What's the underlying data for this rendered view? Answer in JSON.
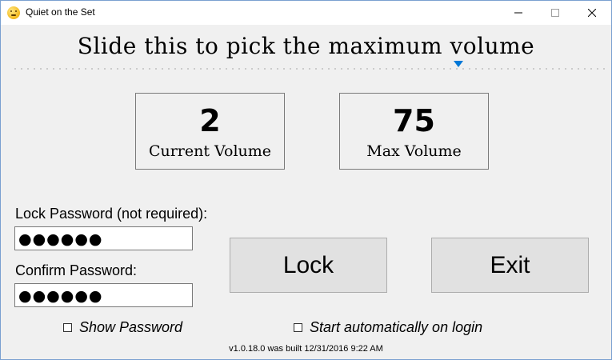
{
  "window": {
    "title": "Quiet on the Set",
    "icon": "smiley-face-icon"
  },
  "headline": "Slide this to pick the maximum volume",
  "slider": {
    "value": 75,
    "min": 0,
    "max": 100,
    "accent_color": "#0078d7"
  },
  "current_volume": {
    "value": "2",
    "label": "Current Volume"
  },
  "max_volume": {
    "value": "75",
    "label": "Max Volume"
  },
  "lock_password": {
    "label": "Lock Password (not required):",
    "masked_value": "●●●●●●"
  },
  "confirm_password": {
    "label": "Confirm Password:",
    "masked_value": "●●●●●●"
  },
  "buttons": {
    "lock": "Lock",
    "exit": "Exit"
  },
  "options": {
    "show_password": {
      "label": "Show Password",
      "checked": false
    },
    "start_auto": {
      "label": "Start automatically on login",
      "checked": false
    }
  },
  "footer": "v1.0.18.0 was built 12/31/2016 9:22 AM"
}
